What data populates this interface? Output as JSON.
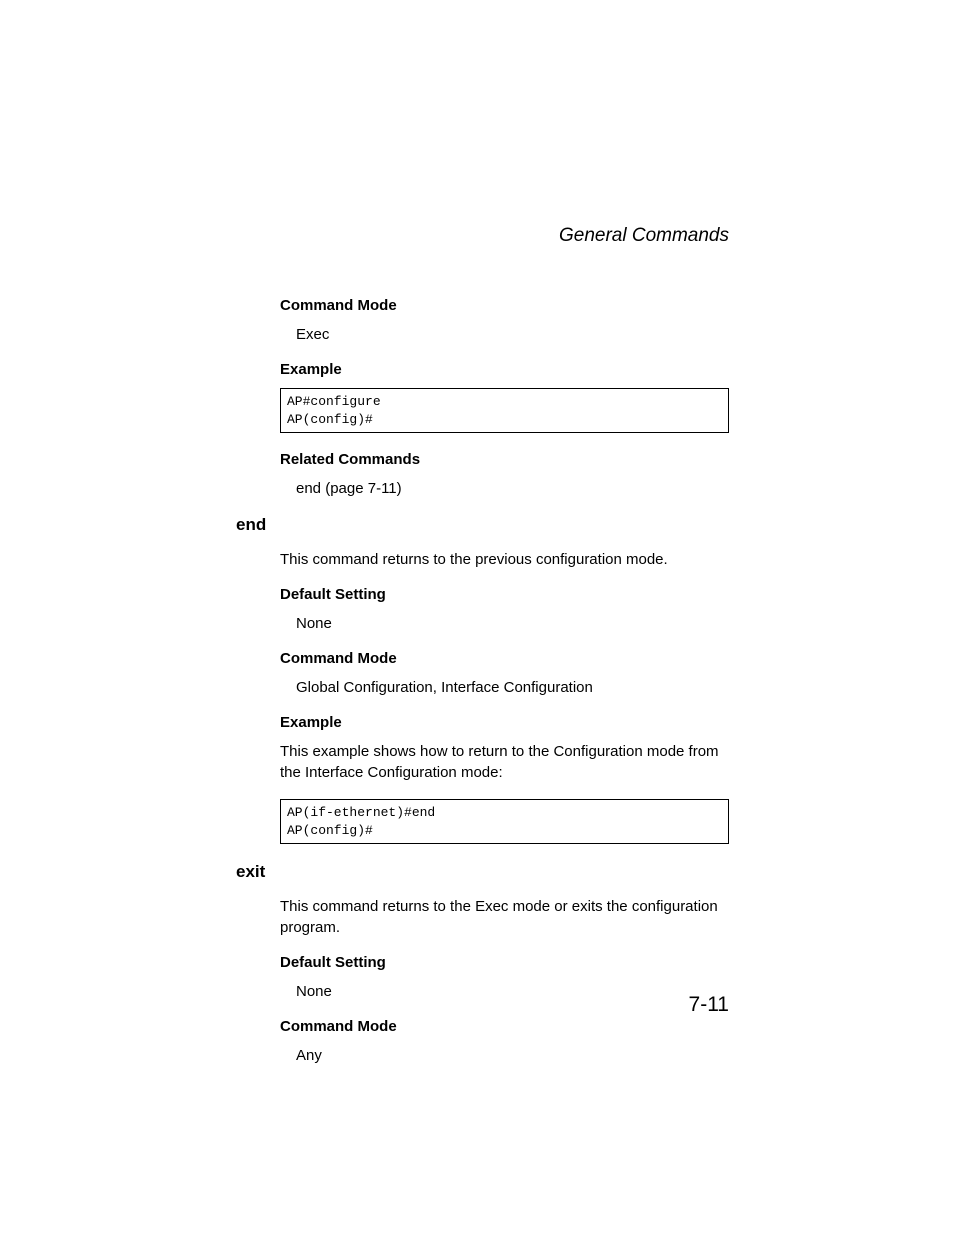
{
  "header": {
    "title": "General Commands"
  },
  "sections": {
    "configure": {
      "command_mode_label": "Command Mode",
      "command_mode_value": "Exec",
      "example_label": "Example",
      "example_code": "AP#configure\nAP(config)#",
      "related_label": "Related Commands",
      "related_value": "end (page 7-11)"
    },
    "end": {
      "name": "end",
      "description": "This command returns to the previous configuration mode.",
      "default_label": "Default Setting",
      "default_value": "None",
      "command_mode_label": "Command Mode",
      "command_mode_value": "Global Configuration, Interface Configuration",
      "example_label": "Example",
      "example_intro": "This example shows how to return to the Configuration mode from the Interface Configuration mode:",
      "example_code": "AP(if-ethernet)#end\nAP(config)#"
    },
    "exit": {
      "name": "exit",
      "description": "This command returns to the Exec mode or exits the configuration program.",
      "default_label": "Default Setting",
      "default_value": "None",
      "command_mode_label": "Command Mode",
      "command_mode_value": "Any"
    }
  },
  "page_number": "7-11"
}
